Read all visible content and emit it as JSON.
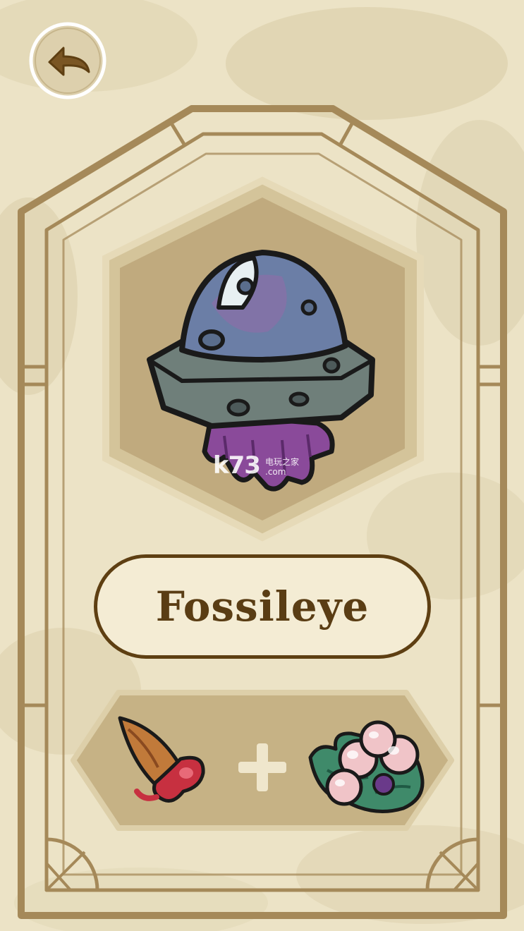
{
  "creature": {
    "name": "Fossileye",
    "icon": "fossil-shell-creature"
  },
  "recipe": {
    "ingredient_1_icon": "bloody-horn",
    "operator": "+",
    "ingredient_2_icon": "berry-bush"
  },
  "back_button": {
    "icon": "back-arrow-icon"
  },
  "watermark": {
    "logo": "k73",
    "sub": "电玩之家",
    "domain": ".com"
  },
  "colors": {
    "parchment": "#ece3c6",
    "frame": "#a58959",
    "plate_border": "#5e3f12",
    "name_text": "#5a3d14",
    "hex_panel": "#c0aa7e"
  }
}
